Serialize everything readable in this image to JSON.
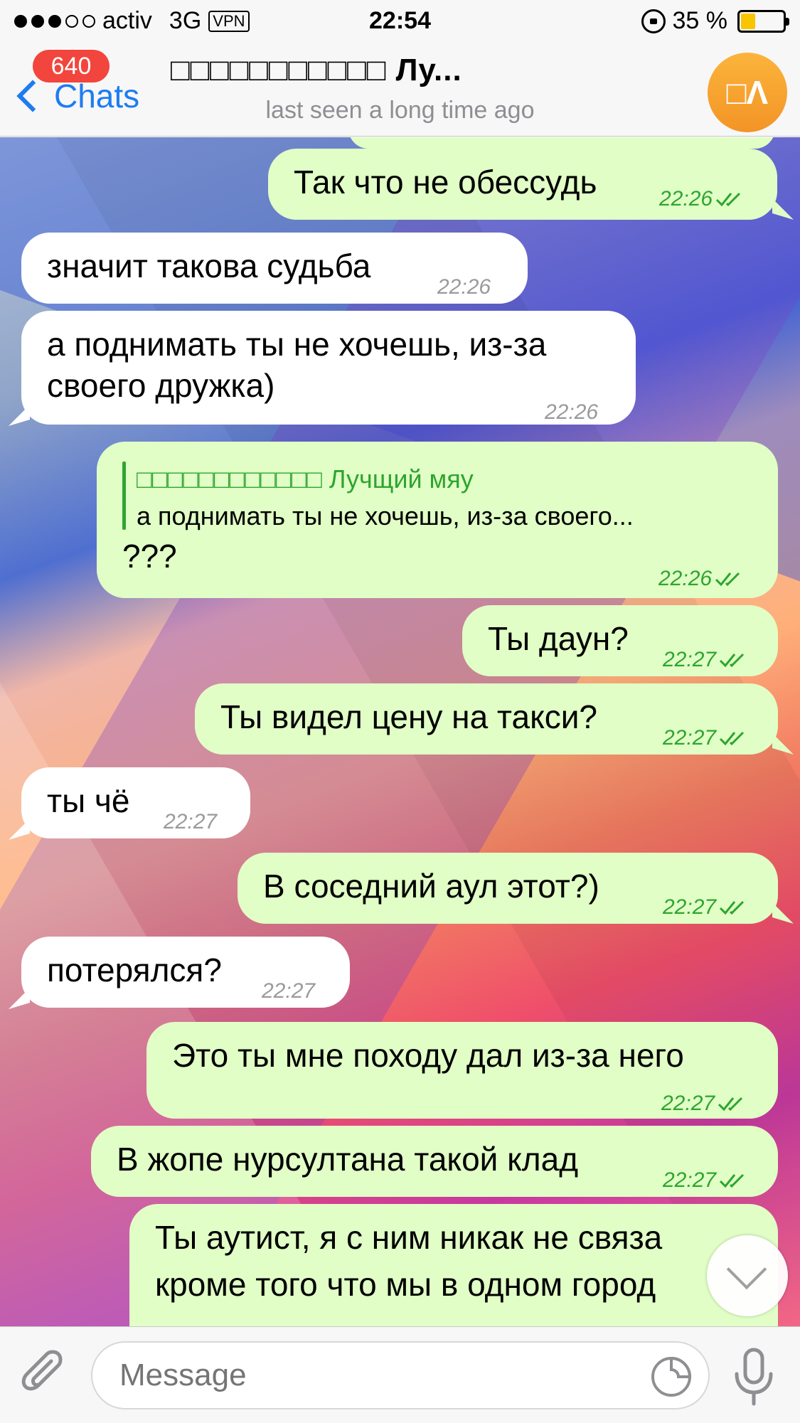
{
  "status_bar": {
    "carrier": "activ",
    "network": "3G",
    "vpn": "VPN",
    "time": "22:54",
    "battery": "35 %",
    "battery_level": 0.35
  },
  "nav": {
    "back_label": "Chats",
    "unread_count": "640",
    "title": "□□□□□□□□□□□ Лу...",
    "subtitle": "last seen a long time ago",
    "avatar_initials": "□Λ"
  },
  "messages": [
    {
      "dir": "out",
      "text": "Так что не обессудь",
      "time": "22:26"
    },
    {
      "dir": "in",
      "text": "значит такова судьба",
      "time": "22:26"
    },
    {
      "dir": "in",
      "text_line1": "а поднимать ты не хочешь, из-за",
      "text_line2": "своего дружка)",
      "time": "22:26"
    },
    {
      "dir": "out",
      "reply_name": "□□□□□□□□□□□□ Лучщий мяу",
      "reply_text": "а поднимать ты не хочешь, из-за своего...",
      "text": "???",
      "time": "22:26"
    },
    {
      "dir": "out",
      "text": "Ты даун?",
      "time": "22:27"
    },
    {
      "dir": "out",
      "text": "Ты видел цену на такси?",
      "time": "22:27"
    },
    {
      "dir": "in",
      "text": "ты чё",
      "time": "22:27"
    },
    {
      "dir": "out",
      "text": "В соседний аул этот?)",
      "time": "22:27"
    },
    {
      "dir": "in",
      "text": "потерялся?",
      "time": "22:27"
    },
    {
      "dir": "out",
      "text": "Это ты мне походу дал из-за него",
      "time": "22:27"
    },
    {
      "dir": "out",
      "text": "В жопе нурсултана такой клад",
      "time": "22:27"
    },
    {
      "dir": "out",
      "text_line1": "Ты аутист, я с ним никак не связа",
      "text_line2": "кроме того что мы в одном город"
    }
  ],
  "input": {
    "placeholder": "Message"
  },
  "colors": {
    "accent": "#1d7cf2",
    "badge": "#f2453d",
    "outgoing_bubble": "#e1fec6",
    "incoming_bubble": "#ffffff",
    "read_check": "#2ea52f"
  },
  "icons": [
    "chevron-left-icon",
    "lock-icon",
    "battery-icon",
    "double-check-icon",
    "chevron-down-icon",
    "paperclip-icon",
    "sticker-icon",
    "microphone-icon"
  ]
}
